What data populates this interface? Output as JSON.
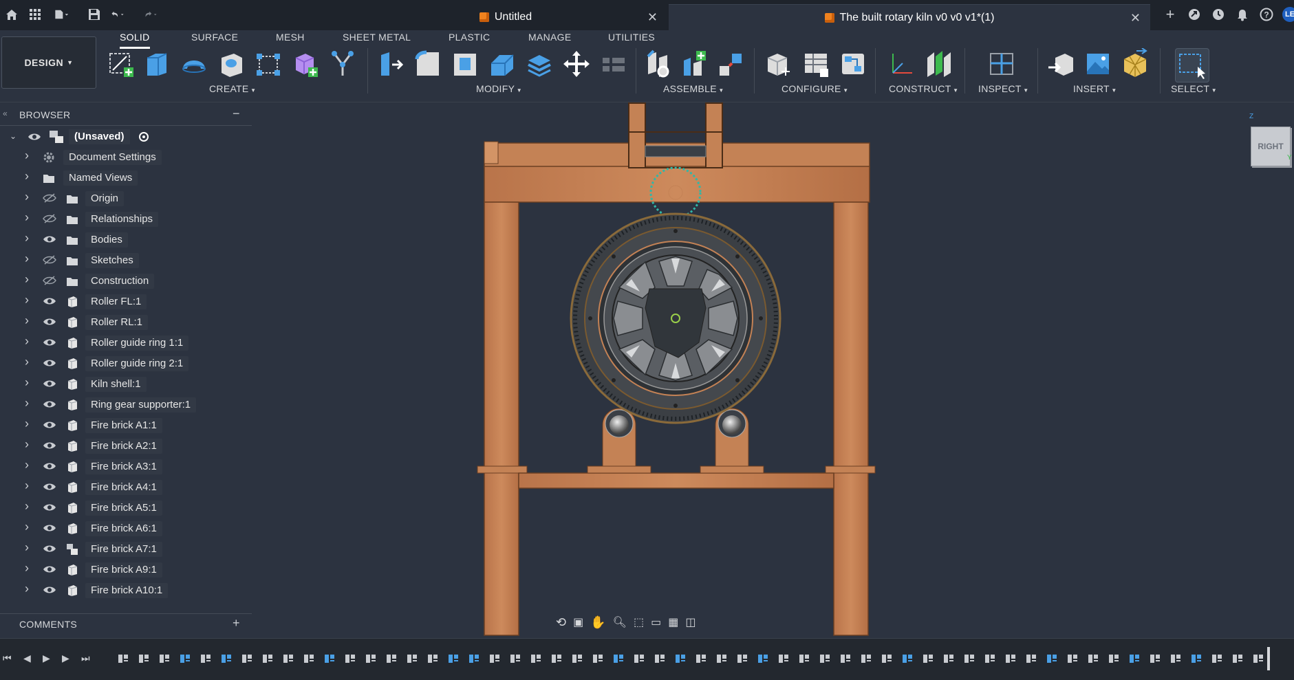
{
  "tabs": [
    {
      "label": "Untitled"
    },
    {
      "label": "The built rotary kiln v0 v0 v1*(1)"
    }
  ],
  "user_initials": "LE",
  "workspace": {
    "label": "DESIGN"
  },
  "workspace_tabs": [
    "SOLID",
    "SURFACE",
    "MESH",
    "SHEET METAL",
    "PLASTIC",
    "MANAGE",
    "UTILITIES"
  ],
  "tool_groups": [
    "CREATE",
    "MODIFY",
    "ASSEMBLE",
    "CONFIGURE",
    "CONSTRUCT",
    "INSPECT",
    "INSERT",
    "SELECT"
  ],
  "browser": {
    "title": "BROWSER",
    "collapse_symbol": "−",
    "root": "(Unsaved)",
    "items": [
      {
        "label": "Document Settings",
        "icon": "gear-icon",
        "visible": null
      },
      {
        "label": "Named Views",
        "icon": "folder-icon",
        "visible": null
      },
      {
        "label": "Origin",
        "icon": "folder-icon",
        "visible": false
      },
      {
        "label": "Relationships",
        "icon": "folder-icon",
        "visible": false
      },
      {
        "label": "Bodies",
        "icon": "folder-icon",
        "visible": true
      },
      {
        "label": "Sketches",
        "icon": "folder-icon",
        "visible": false
      },
      {
        "label": "Construction",
        "icon": "folder-icon",
        "visible": false
      },
      {
        "label": "Roller FL:1",
        "icon": "component-icon",
        "visible": true
      },
      {
        "label": "Roller RL:1",
        "icon": "component-icon",
        "visible": true
      },
      {
        "label": "Roller guide ring 1:1",
        "icon": "component-icon",
        "visible": true
      },
      {
        "label": "Roller guide ring 2:1",
        "icon": "component-icon",
        "visible": true
      },
      {
        "label": "Kiln shell:1",
        "icon": "component-icon",
        "visible": true
      },
      {
        "label": "Ring gear supporter:1",
        "icon": "component-icon",
        "visible": true
      },
      {
        "label": "Fire brick A1:1",
        "icon": "component-icon",
        "visible": true
      },
      {
        "label": "Fire brick A2:1",
        "icon": "component-icon",
        "visible": true
      },
      {
        "label": "Fire brick A3:1",
        "icon": "component-icon",
        "visible": true
      },
      {
        "label": "Fire brick A4:1",
        "icon": "component-icon",
        "visible": true
      },
      {
        "label": "Fire brick A5:1",
        "icon": "component-icon",
        "visible": true
      },
      {
        "label": "Fire brick A6:1",
        "icon": "component-icon",
        "visible": true
      },
      {
        "label": "Fire brick A7:1",
        "icon": "assembly-icon",
        "visible": true
      },
      {
        "label": "Fire brick A9:1",
        "icon": "component-icon",
        "visible": true
      },
      {
        "label": "Fire brick A10:1",
        "icon": "component-icon",
        "visible": true
      }
    ]
  },
  "comments": {
    "title": "COMMENTS",
    "add_symbol": "+"
  },
  "viewcube": {
    "face": "RIGHT",
    "axis_z": "Z",
    "axis_y": "Y"
  },
  "colors": {
    "wood": "#c58255",
    "accent": "#f0821e",
    "background": "#2c3340"
  }
}
